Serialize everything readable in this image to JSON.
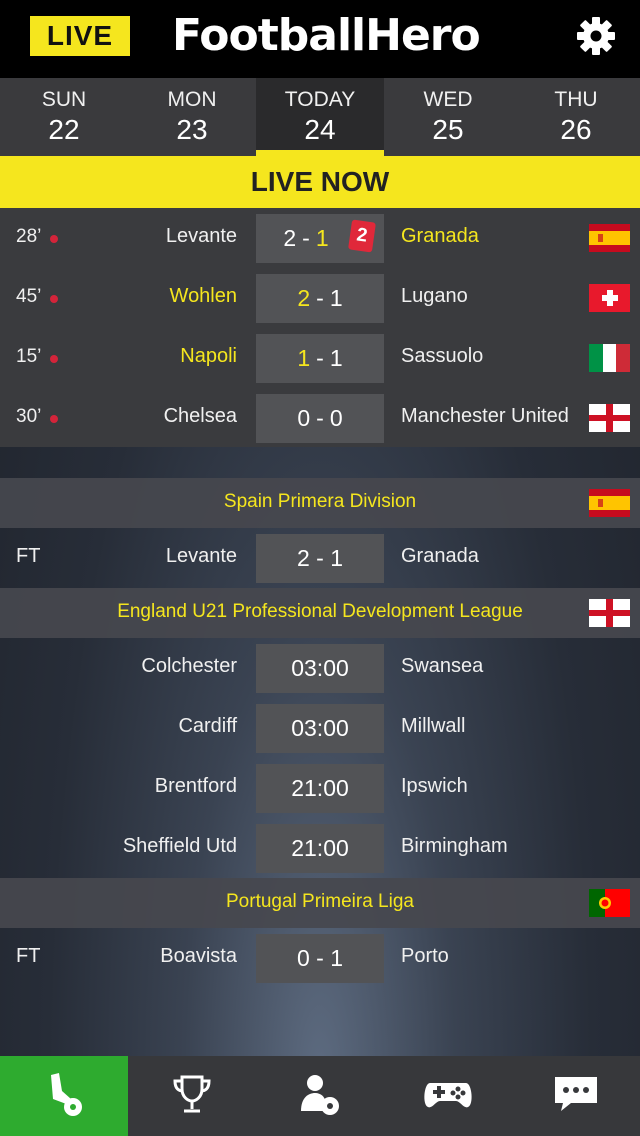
{
  "header": {
    "live_label": "LIVE",
    "brand": "FootballHero",
    "settings_icon": "gear-icon"
  },
  "dates": [
    {
      "dow": "SUN",
      "num": "22"
    },
    {
      "dow": "MON",
      "num": "23"
    },
    {
      "dow": "TODAY",
      "num": "24",
      "active": true
    },
    {
      "dow": "WED",
      "num": "25"
    },
    {
      "dow": "THU",
      "num": "26"
    }
  ],
  "live_now_label": "LIVE NOW",
  "live_matches": [
    {
      "minute": "28’",
      "home": "Levante",
      "home_score": "2",
      "away_score": "1",
      "away": "Granada",
      "leader": "away",
      "red_cards": "2",
      "flag": "spain"
    },
    {
      "minute": "45’",
      "home": "Wohlen",
      "home_score": "2",
      "away_score": "1",
      "away": "Lugano",
      "leader": "home",
      "flag": "switzerland"
    },
    {
      "minute": "15’",
      "home": "Napoli",
      "home_score": "1",
      "away_score": "1",
      "away": "Sassuolo",
      "leader": "home",
      "flag": "italy"
    },
    {
      "minute": "30’",
      "home": "Chelsea",
      "home_score": "0",
      "away_score": "0",
      "away": "Manchester United",
      "leader": "none",
      "flag": "england"
    }
  ],
  "leagues": [
    {
      "name": "Spain Primera Division",
      "flag": "spain",
      "matches": [
        {
          "status": "FT",
          "home": "Levante",
          "score": "2 - 1",
          "away": "Granada"
        }
      ]
    },
    {
      "name": "England U21 Professional Development League",
      "flag": "england",
      "matches": [
        {
          "status": "",
          "home": "Colchester",
          "score": "03:00",
          "away": "Swansea"
        },
        {
          "status": "",
          "home": "Cardiff",
          "score": "03:00",
          "away": "Millwall"
        },
        {
          "status": "",
          "home": "Brentford",
          "score": "21:00",
          "away": "Ipswich"
        },
        {
          "status": "",
          "home": "Sheffield Utd",
          "score": "21:00",
          "away": "Birmingham"
        }
      ]
    },
    {
      "name": "Portugal Primeira Liga",
      "flag": "portugal",
      "matches": [
        {
          "status": "FT",
          "home": "Boavista",
          "score": "0 - 1",
          "away": "Porto"
        }
      ]
    }
  ],
  "bottom_nav": [
    {
      "icon": "boot-ball-icon",
      "active": true
    },
    {
      "icon": "trophy-icon"
    },
    {
      "icon": "user-ball-icon"
    },
    {
      "icon": "gamepad-icon"
    },
    {
      "icon": "chat-icon"
    }
  ],
  "colors": {
    "accent_yellow": "#f5e61e",
    "live_red": "#d3243a",
    "nav_green": "#2eab2f",
    "bg_dark": "#000000"
  }
}
